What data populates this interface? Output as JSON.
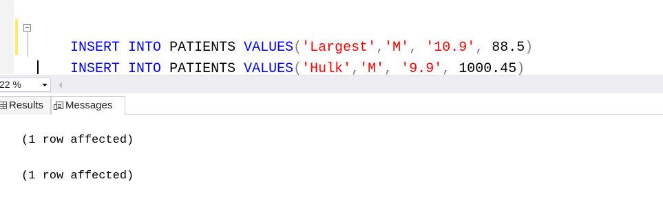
{
  "editor": {
    "lines": [
      {
        "tokens": [
          {
            "text": "INSERT",
            "kind": "kw"
          },
          {
            "text": " ",
            "kind": "plain"
          },
          {
            "text": "INTO",
            "kind": "kw"
          },
          {
            "text": " PATIENTS ",
            "kind": "plain"
          },
          {
            "text": "VALUES",
            "kind": "kw"
          },
          {
            "text": "(",
            "kind": "punc"
          },
          {
            "text": "'Largest'",
            "kind": "str"
          },
          {
            "text": ",",
            "kind": "punc"
          },
          {
            "text": "'M'",
            "kind": "str"
          },
          {
            "text": ",",
            "kind": "punc"
          },
          {
            "text": " ",
            "kind": "plain"
          },
          {
            "text": "'10.9'",
            "kind": "str"
          },
          {
            "text": ",",
            "kind": "punc"
          },
          {
            "text": " 88.5",
            "kind": "plain"
          },
          {
            "text": ")",
            "kind": "punc"
          }
        ]
      },
      {
        "tokens": [
          {
            "text": "INSERT",
            "kind": "kw"
          },
          {
            "text": " ",
            "kind": "plain"
          },
          {
            "text": "INTO",
            "kind": "kw"
          },
          {
            "text": " PATIENTS ",
            "kind": "plain"
          },
          {
            "text": "VALUES",
            "kind": "kw"
          },
          {
            "text": "(",
            "kind": "punc"
          },
          {
            "text": "'Hulk'",
            "kind": "str"
          },
          {
            "text": ",",
            "kind": "punc"
          },
          {
            "text": "'M'",
            "kind": "str"
          },
          {
            "text": ",",
            "kind": "punc"
          },
          {
            "text": " ",
            "kind": "plain"
          },
          {
            "text": "'9.9'",
            "kind": "str"
          },
          {
            "text": ",",
            "kind": "punc"
          },
          {
            "text": " 1000.45",
            "kind": "plain"
          },
          {
            "text": ")",
            "kind": "punc"
          }
        ]
      }
    ]
  },
  "zoom": {
    "value": "22 %"
  },
  "tabs": {
    "results_label": "Results",
    "messages_label": "Messages"
  },
  "messages": [
    "(1 row affected)",
    "(1 row affected)"
  ],
  "colors": {
    "keyword": "#0000ff",
    "string": "#ff0000",
    "punctuation": "#808080",
    "change_bar": "#ffee62"
  },
  "icons": {
    "collapse": "minus-box-icon",
    "results_tab": "grid-icon",
    "messages_tab": "messages-icon",
    "zoom_dropdown": "chevron-down-icon",
    "scroll_left": "arrow-left-icon"
  }
}
